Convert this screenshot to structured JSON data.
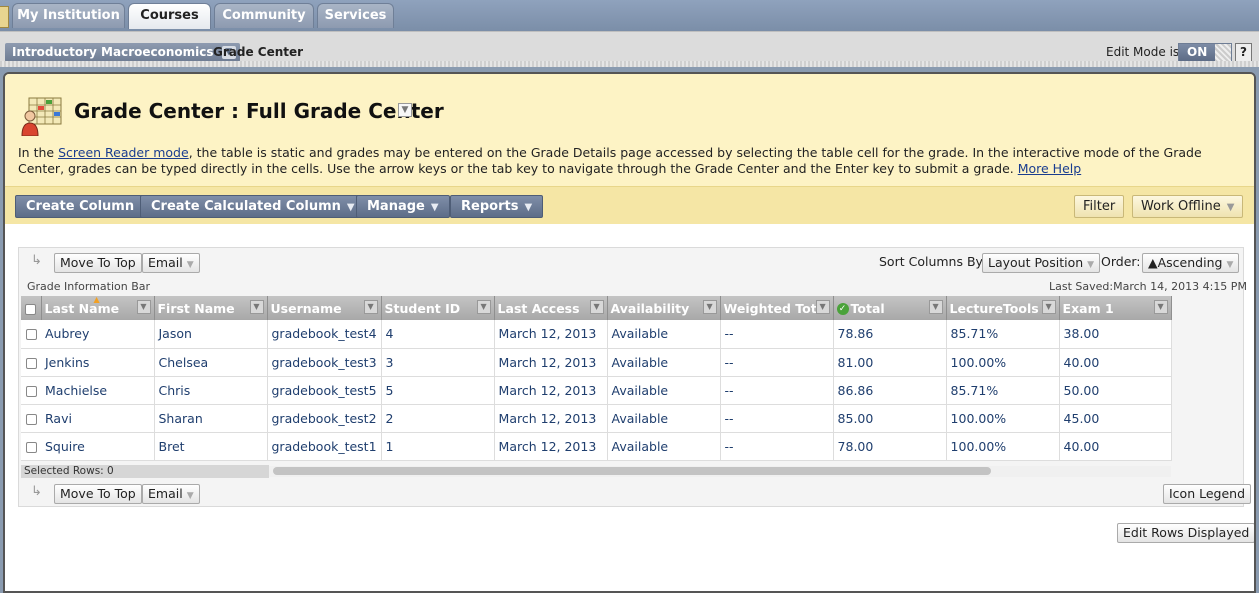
{
  "nav": {
    "tabs": [
      {
        "label": "My Institution"
      },
      {
        "label": "Courses"
      },
      {
        "label": "Community"
      },
      {
        "label": "Services"
      }
    ]
  },
  "breadcrumb": {
    "course": "Introductory Macroeconomics",
    "page": "Grade Center"
  },
  "edit_mode": {
    "label": "Edit Mode is:",
    "value": "ON",
    "help": "?"
  },
  "header": {
    "title": "Grade Center : Full Grade Center",
    "desc_prefix": "In the ",
    "desc_link": "Screen Reader mode",
    "desc_body": ", the table is static and grades may be entered on the Grade Details page accessed by selecting the table cell for the grade. In the interactive mode of the Grade Center, grades can be typed directly in the cells. Use the arrow keys or the tab key to navigate through the Grade Center and the Enter key to submit a grade. ",
    "more_help": "More Help"
  },
  "actions": {
    "create_column": "Create Column",
    "create_calculated": "Create Calculated Column",
    "manage": "Manage",
    "reports": "Reports",
    "filter": "Filter",
    "work_offline": "Work Offline"
  },
  "grid": {
    "move_to_top": "Move To Top",
    "email": "Email",
    "sort_label": "Sort Columns By:",
    "sort_value": "Layout Position",
    "order_label": "Order:",
    "order_value": "▲Ascending",
    "info_bar": "Grade Information Bar",
    "last_saved": "Last Saved:March 14, 2013 4:15 PM",
    "selected_rows": "Selected Rows: 0",
    "icon_legend": "Icon Legend",
    "edit_rows": "Edit Rows Displayed",
    "columns": [
      "Last Name",
      "First Name",
      "Username",
      "Student ID",
      "Last Access",
      "Availability",
      "Weighted Total",
      "Total",
      "LectureTools",
      "Exam 1"
    ],
    "rows": [
      [
        "Aubrey",
        "Jason",
        "gradebook_test4",
        "4",
        "March 12, 2013",
        "Available",
        "--",
        "78.86",
        "85.71%",
        "38.00"
      ],
      [
        "Jenkins",
        "Chelsea",
        "gradebook_test3",
        "3",
        "March 12, 2013",
        "Available",
        "--",
        "81.00",
        "100.00%",
        "40.00"
      ],
      [
        "Machielse",
        "Chris",
        "gradebook_test5",
        "5",
        "March 12, 2013",
        "Available",
        "--",
        "86.86",
        "85.71%",
        "50.00"
      ],
      [
        "Ravi",
        "Sharan",
        "gradebook_test2",
        "2",
        "March 12, 2013",
        "Available",
        "--",
        "85.00",
        "100.00%",
        "45.00"
      ],
      [
        "Squire",
        "Bret",
        "gradebook_test1",
        "1",
        "March 12, 2013",
        "Available",
        "--",
        "78.00",
        "100.00%",
        "40.00"
      ]
    ]
  }
}
